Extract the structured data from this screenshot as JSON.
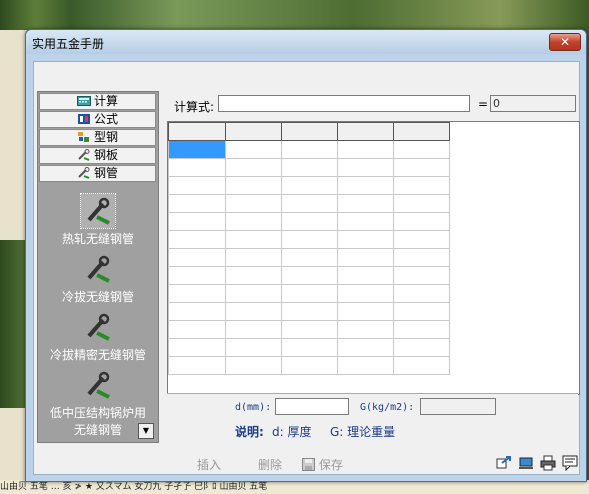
{
  "window": {
    "title": "实用五金手册",
    "close_symbol": "✕"
  },
  "categories": [
    {
      "label": "计算",
      "icon": "calculator-icon"
    },
    {
      "label": "公式",
      "icon": "formula-book-icon"
    },
    {
      "label": "型钢",
      "icon": "section-steel-icon"
    },
    {
      "label": "钢板",
      "icon": "steel-plate-icon"
    },
    {
      "label": "钢管",
      "icon": "steel-pipe-icon"
    }
  ],
  "tools": [
    {
      "label": "热轧无缝钢管",
      "icon": "wrench-tool-icon"
    },
    {
      "label": "冷拔无缝钢管",
      "icon": "wrench-tool-icon"
    },
    {
      "label": "冷拔精密无缝钢管",
      "icon": "wrench-tool-icon"
    },
    {
      "label_line1": "低中压结构锅炉用",
      "label_line2": "无缝钢管",
      "icon": "wrench-tool-icon"
    }
  ],
  "formula": {
    "label": "计算式:",
    "value": "",
    "equals": "=",
    "result": "0"
  },
  "inputs": {
    "d_label": "d(mm):",
    "d_value": "",
    "g_label": "G(kg/m2):",
    "g_value": ""
  },
  "legend": {
    "title": "说明:",
    "d": "d: 厚度",
    "g": "G: 理论重量"
  },
  "footer": {
    "insert": "插入",
    "delete": "删除",
    "save": "保存"
  },
  "desktop": {
    "taskbar_text": "山由贝 五笔 … 亥 ≯ ★ 又スマム 女刀九 子孑孒 巳阝ﾛ 山由贝 五笔"
  },
  "colors": {
    "selected_cell": "#3399ff",
    "tool_panel": "#a0a0a0",
    "accent_text": "#1a3a8a"
  }
}
